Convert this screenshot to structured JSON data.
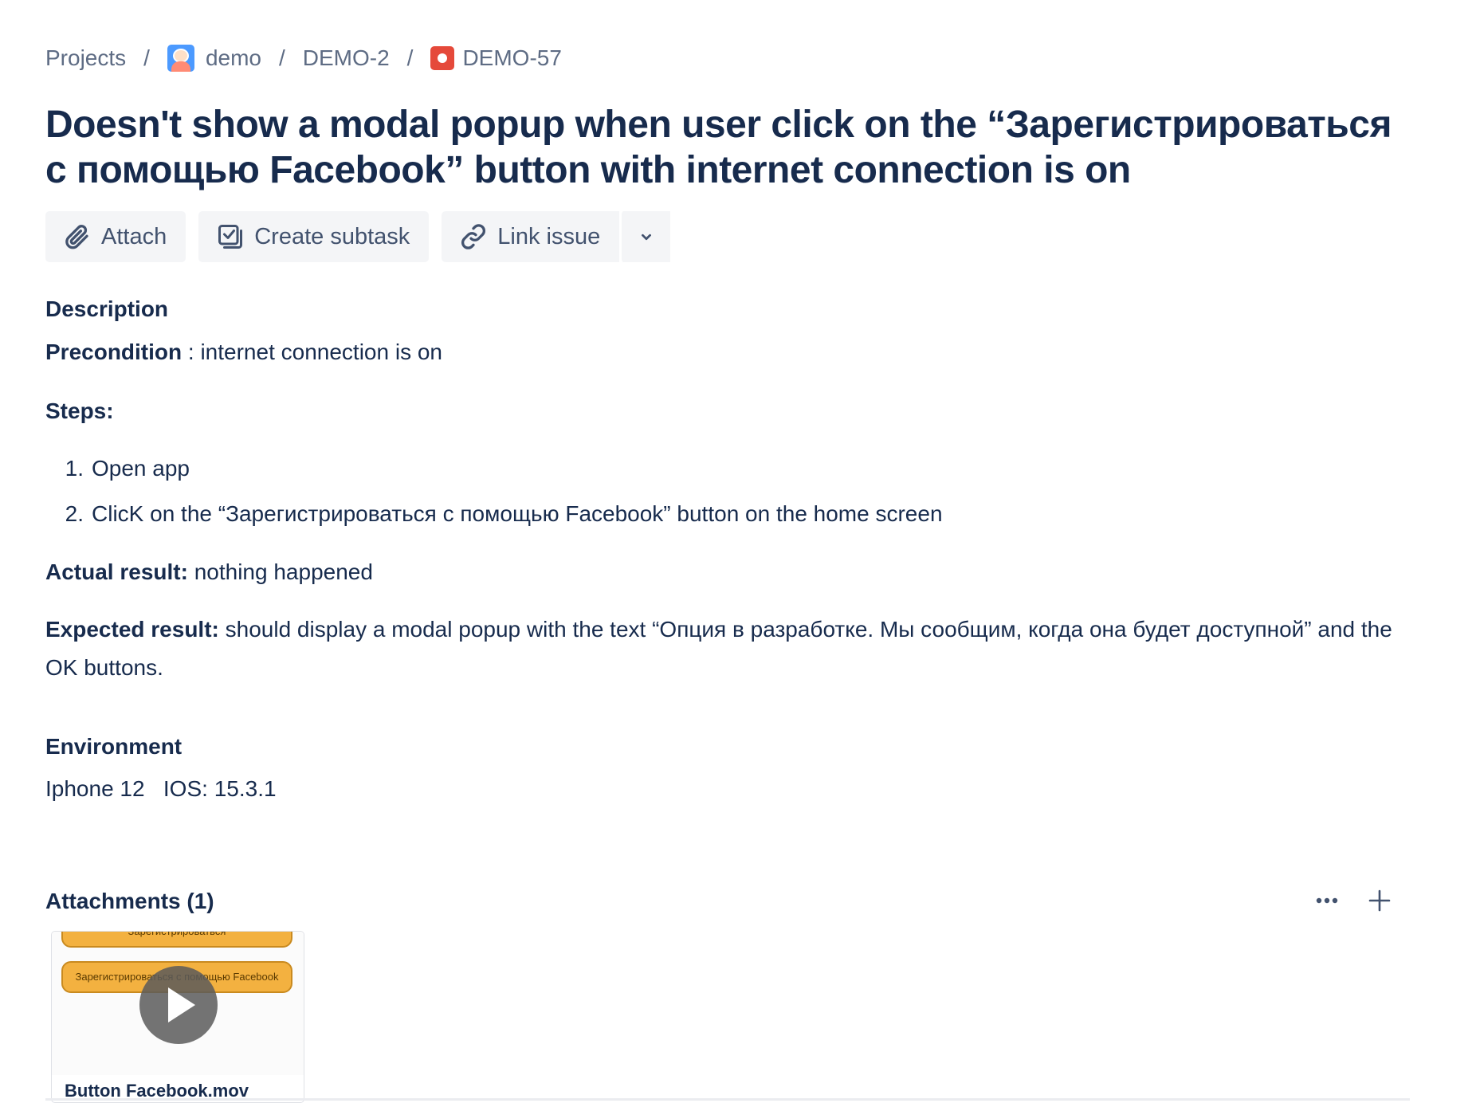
{
  "breadcrumb": {
    "projects": "Projects",
    "project": "demo",
    "epic": "DEMO-2",
    "issue": "DEMO-57",
    "separator": "/"
  },
  "issue": {
    "title": "Doesn't show a modal popup when user click on the “Зарегистрироваться с помощью Facebook” button with internet connection is on"
  },
  "toolbar": {
    "attach_label": "Attach",
    "create_subtask_label": "Create subtask",
    "link_issue_label": "Link issue"
  },
  "description": {
    "heading": "Description",
    "precondition_label": "Precondition",
    "precondition_text": " : internet connection is on",
    "steps_label": "Steps:",
    "steps": [
      {
        "num": "1.",
        "text": "Open app"
      },
      {
        "num": "2.",
        "text": "ClicK on the “Зарегистрироваться с помощью Facebook” button on the home screen"
      }
    ],
    "actual_label": "Actual result:",
    "actual_text": " nothing happened",
    "expected_label": "Expected result:",
    "expected_text": " should display a modal popup with the text “Опция в разработке. Мы сообщим, когда она будет доступной” and the OK buttons."
  },
  "environment": {
    "heading": "Environment",
    "value": "Iphone 12   IOS: 15.3.1"
  },
  "attachments": {
    "heading": "Attachments (1)",
    "items": [
      {
        "filename": "Button Facebook.mov",
        "thumb_top_text": "Зарегистрироваться",
        "thumb_button_text": "Зарегистрироваться с помощью Facebook"
      }
    ]
  },
  "colors": {
    "text": "#172b4d",
    "subtle_text": "#5e6c84",
    "button_bg": "#f4f5f7",
    "bug": "#e5493a",
    "thumb_orange": "#f3b140"
  },
  "icons": [
    "paperclip-icon",
    "subtask-icon",
    "link-icon",
    "chevron-down-icon",
    "more-icon",
    "plus-icon",
    "play-icon",
    "bug-icon"
  ]
}
